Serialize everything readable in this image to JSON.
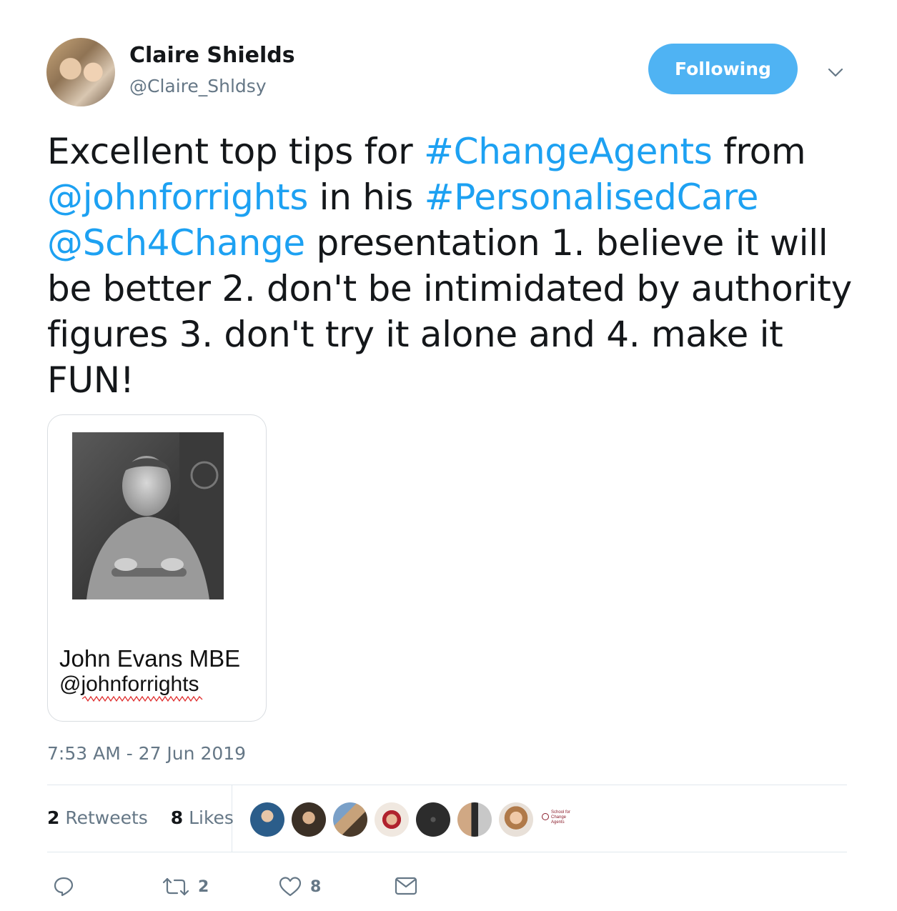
{
  "header": {
    "name": "Claire Shields",
    "handle": "@Claire_Shldsy",
    "follow_label": "Following"
  },
  "tweet": {
    "segments": [
      {
        "text": "Excellent top tips for ",
        "link": false
      },
      {
        "text": "#ChangeAgents",
        "link": true
      },
      {
        "text": " from ",
        "link": false
      },
      {
        "text": "@johnforrights",
        "link": true
      },
      {
        "text": " in his ",
        "link": false
      },
      {
        "text": "#PersonalisedCare",
        "link": true
      },
      {
        "text": " ",
        "link": false
      },
      {
        "text": "@Sch4Change",
        "link": true
      },
      {
        "text": " presentation 1. believe it will be better 2. don't be intimidated by authority figures 3. don't try it alone and 4. make it FUN!",
        "link": false
      }
    ]
  },
  "card": {
    "name": "John Evans MBE",
    "handle": "@johnforrights"
  },
  "timestamp": "7:53 AM - 27 Jun 2019",
  "stats": {
    "retweets_count": "2",
    "retweets_label": "Retweets",
    "likes_count": "8",
    "likes_label": "Likes"
  },
  "liker_logo_text": "School for Change Agents",
  "actions": {
    "reply_icon": "reply-icon",
    "retweet_icon": "retweet-icon",
    "retweet_count": "2",
    "like_icon": "heart-icon",
    "like_count": "8",
    "dm_icon": "envelope-icon"
  },
  "colors": {
    "link": "#1da1f2",
    "follow_button": "#4fb3f3",
    "secondary_text": "#657786"
  }
}
